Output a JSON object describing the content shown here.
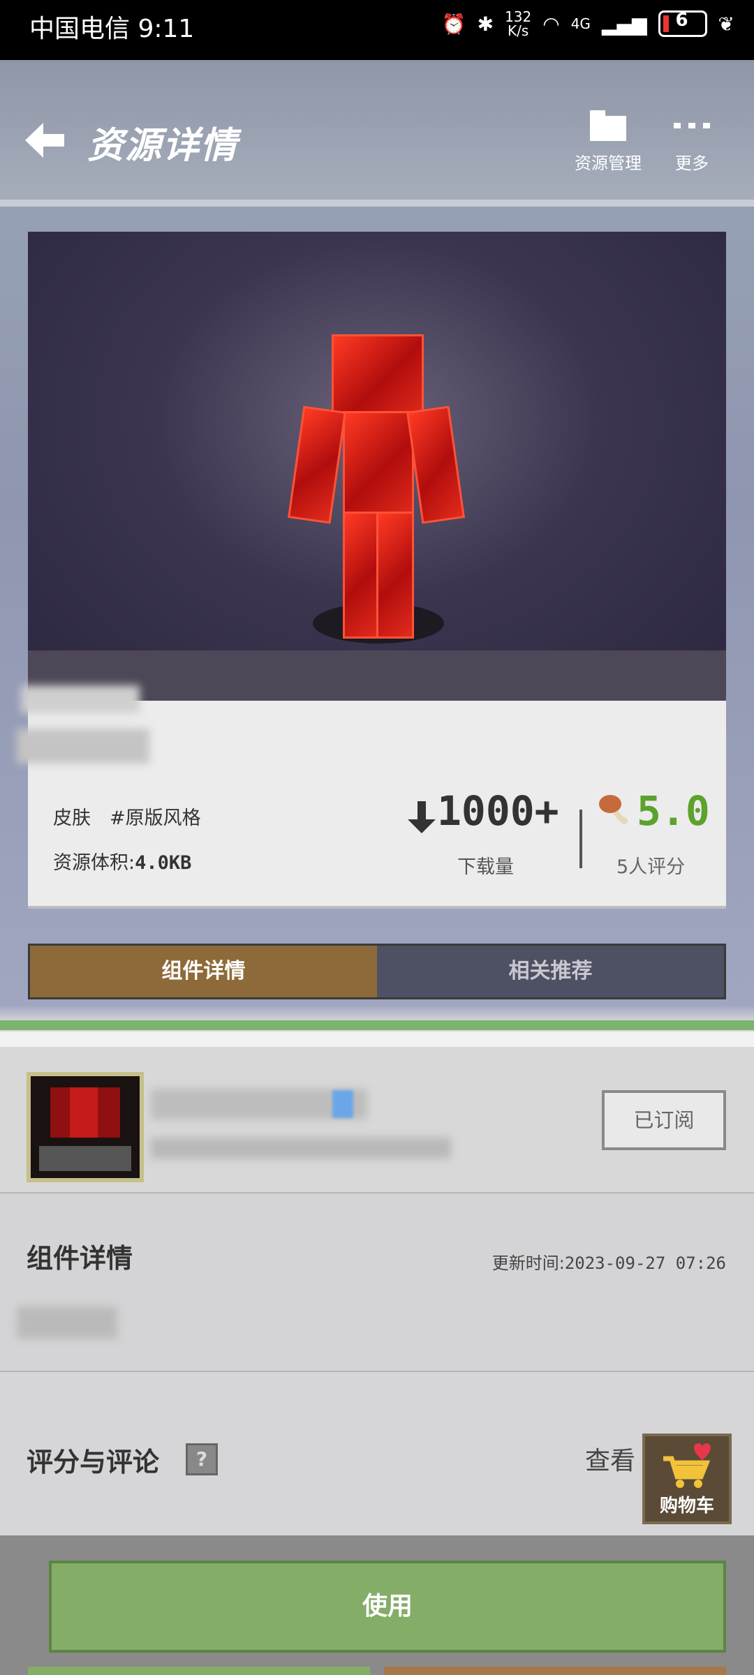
{
  "status_bar": {
    "carrier_time": "中国电信 9:11",
    "net_speed_top": "132",
    "net_speed_bottom": "K/s",
    "network": "4G",
    "battery": "6"
  },
  "header": {
    "back_icon": "arrow-left-icon",
    "title": "资源详情",
    "manage_label": "资源管理",
    "more_label": "更多"
  },
  "resource": {
    "tag": "皮肤　#原版风格",
    "size_label": "资源体积:",
    "size_value": "4.0KB",
    "downloads_value": "1000+",
    "downloads_label": "下载量",
    "rating_value": "5.0",
    "rating_label": "5人评分"
  },
  "tabs": [
    {
      "label": "组件详情",
      "active": true
    },
    {
      "label": "相关推荐",
      "active": false
    }
  ],
  "author": {
    "subscribe_label": "已订阅"
  },
  "details": {
    "title": "组件详情",
    "updated_label": "更新时间:",
    "updated_value": "2023-09-27 07:26"
  },
  "reviews": {
    "title": "评分与评论",
    "see_all": "查看"
  },
  "cart": {
    "label": "购物车"
  },
  "actions": {
    "use_label": "使用"
  },
  "colors": {
    "accent_green": "#84ad68",
    "rating_green": "#5ca22c",
    "tab_active": "#8e6a3a",
    "tab_inactive": "#4e5063"
  }
}
